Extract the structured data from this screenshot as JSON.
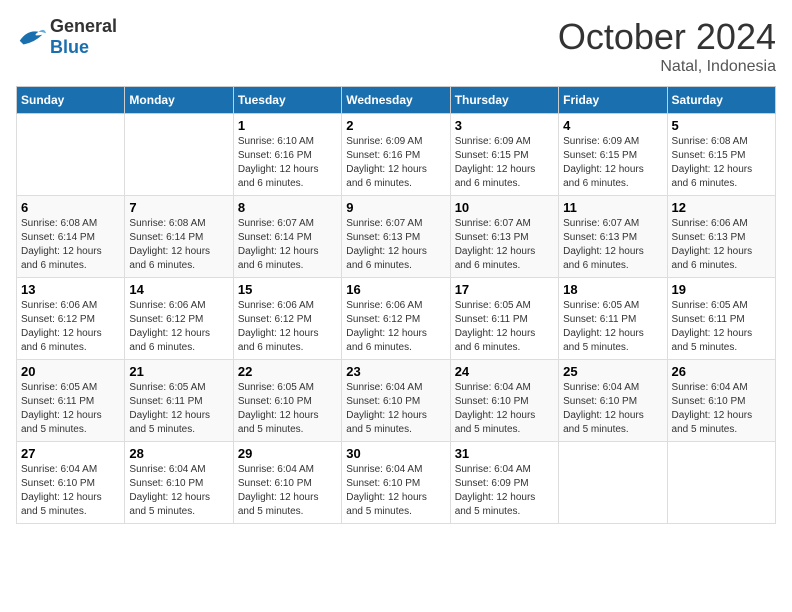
{
  "logo": {
    "general": "General",
    "blue": "Blue"
  },
  "title": "October 2024",
  "location": "Natal, Indonesia",
  "days_header": [
    "Sunday",
    "Monday",
    "Tuesday",
    "Wednesday",
    "Thursday",
    "Friday",
    "Saturday"
  ],
  "weeks": [
    [
      {
        "day": "",
        "info": ""
      },
      {
        "day": "",
        "info": ""
      },
      {
        "day": "1",
        "info": "Sunrise: 6:10 AM\nSunset: 6:16 PM\nDaylight: 12 hours and 6 minutes."
      },
      {
        "day": "2",
        "info": "Sunrise: 6:09 AM\nSunset: 6:16 PM\nDaylight: 12 hours and 6 minutes."
      },
      {
        "day": "3",
        "info": "Sunrise: 6:09 AM\nSunset: 6:15 PM\nDaylight: 12 hours and 6 minutes."
      },
      {
        "day": "4",
        "info": "Sunrise: 6:09 AM\nSunset: 6:15 PM\nDaylight: 12 hours and 6 minutes."
      },
      {
        "day": "5",
        "info": "Sunrise: 6:08 AM\nSunset: 6:15 PM\nDaylight: 12 hours and 6 minutes."
      }
    ],
    [
      {
        "day": "6",
        "info": "Sunrise: 6:08 AM\nSunset: 6:14 PM\nDaylight: 12 hours and 6 minutes."
      },
      {
        "day": "7",
        "info": "Sunrise: 6:08 AM\nSunset: 6:14 PM\nDaylight: 12 hours and 6 minutes."
      },
      {
        "day": "8",
        "info": "Sunrise: 6:07 AM\nSunset: 6:14 PM\nDaylight: 12 hours and 6 minutes."
      },
      {
        "day": "9",
        "info": "Sunrise: 6:07 AM\nSunset: 6:13 PM\nDaylight: 12 hours and 6 minutes."
      },
      {
        "day": "10",
        "info": "Sunrise: 6:07 AM\nSunset: 6:13 PM\nDaylight: 12 hours and 6 minutes."
      },
      {
        "day": "11",
        "info": "Sunrise: 6:07 AM\nSunset: 6:13 PM\nDaylight: 12 hours and 6 minutes."
      },
      {
        "day": "12",
        "info": "Sunrise: 6:06 AM\nSunset: 6:13 PM\nDaylight: 12 hours and 6 minutes."
      }
    ],
    [
      {
        "day": "13",
        "info": "Sunrise: 6:06 AM\nSunset: 6:12 PM\nDaylight: 12 hours and 6 minutes."
      },
      {
        "day": "14",
        "info": "Sunrise: 6:06 AM\nSunset: 6:12 PM\nDaylight: 12 hours and 6 minutes."
      },
      {
        "day": "15",
        "info": "Sunrise: 6:06 AM\nSunset: 6:12 PM\nDaylight: 12 hours and 6 minutes."
      },
      {
        "day": "16",
        "info": "Sunrise: 6:06 AM\nSunset: 6:12 PM\nDaylight: 12 hours and 6 minutes."
      },
      {
        "day": "17",
        "info": "Sunrise: 6:05 AM\nSunset: 6:11 PM\nDaylight: 12 hours and 6 minutes."
      },
      {
        "day": "18",
        "info": "Sunrise: 6:05 AM\nSunset: 6:11 PM\nDaylight: 12 hours and 5 minutes."
      },
      {
        "day": "19",
        "info": "Sunrise: 6:05 AM\nSunset: 6:11 PM\nDaylight: 12 hours and 5 minutes."
      }
    ],
    [
      {
        "day": "20",
        "info": "Sunrise: 6:05 AM\nSunset: 6:11 PM\nDaylight: 12 hours and 5 minutes."
      },
      {
        "day": "21",
        "info": "Sunrise: 6:05 AM\nSunset: 6:11 PM\nDaylight: 12 hours and 5 minutes."
      },
      {
        "day": "22",
        "info": "Sunrise: 6:05 AM\nSunset: 6:10 PM\nDaylight: 12 hours and 5 minutes."
      },
      {
        "day": "23",
        "info": "Sunrise: 6:04 AM\nSunset: 6:10 PM\nDaylight: 12 hours and 5 minutes."
      },
      {
        "day": "24",
        "info": "Sunrise: 6:04 AM\nSunset: 6:10 PM\nDaylight: 12 hours and 5 minutes."
      },
      {
        "day": "25",
        "info": "Sunrise: 6:04 AM\nSunset: 6:10 PM\nDaylight: 12 hours and 5 minutes."
      },
      {
        "day": "26",
        "info": "Sunrise: 6:04 AM\nSunset: 6:10 PM\nDaylight: 12 hours and 5 minutes."
      }
    ],
    [
      {
        "day": "27",
        "info": "Sunrise: 6:04 AM\nSunset: 6:10 PM\nDaylight: 12 hours and 5 minutes."
      },
      {
        "day": "28",
        "info": "Sunrise: 6:04 AM\nSunset: 6:10 PM\nDaylight: 12 hours and 5 minutes."
      },
      {
        "day": "29",
        "info": "Sunrise: 6:04 AM\nSunset: 6:10 PM\nDaylight: 12 hours and 5 minutes."
      },
      {
        "day": "30",
        "info": "Sunrise: 6:04 AM\nSunset: 6:10 PM\nDaylight: 12 hours and 5 minutes."
      },
      {
        "day": "31",
        "info": "Sunrise: 6:04 AM\nSunset: 6:09 PM\nDaylight: 12 hours and 5 minutes."
      },
      {
        "day": "",
        "info": ""
      },
      {
        "day": "",
        "info": ""
      }
    ]
  ]
}
